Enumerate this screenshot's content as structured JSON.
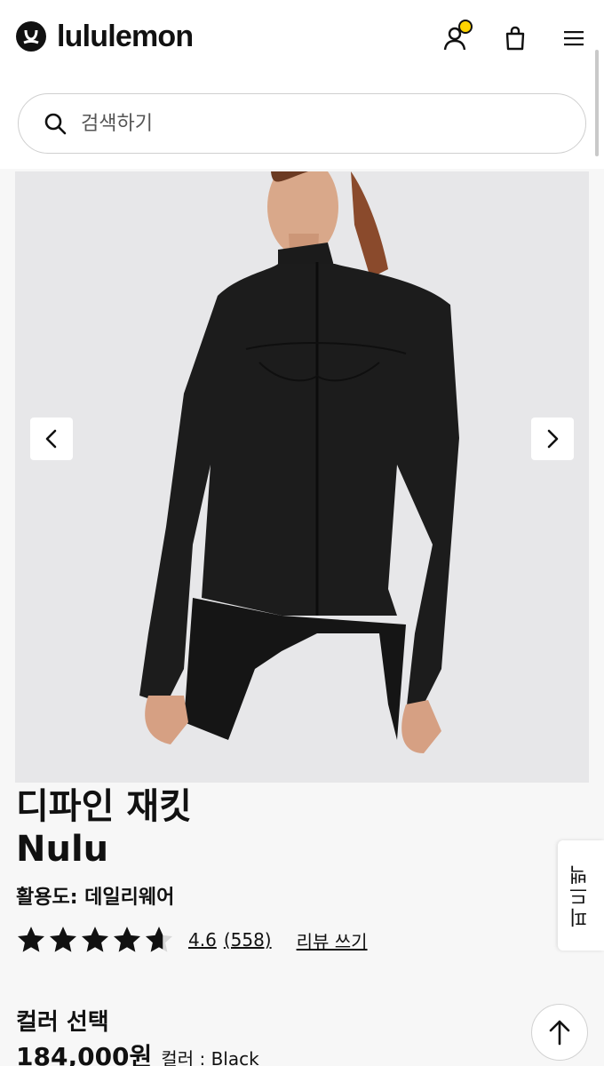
{
  "brand": {
    "name": "lululemon"
  },
  "header": {
    "account_icon": "user-icon",
    "bag_icon": "bag-icon",
    "menu_icon": "hamburger-menu-icon",
    "notification_color": "#ffd400"
  },
  "search": {
    "placeholder": "검색하기",
    "icon": "search-icon"
  },
  "gallery": {
    "prev_icon": "chevron-left-icon",
    "next_icon": "chevron-right-icon"
  },
  "product": {
    "name_line1": "디파인 재킷",
    "name_line2": "Nulu",
    "usage": "활용도: 데일리웨어",
    "rating": "4.6",
    "rating_value": 4.6,
    "review_count": "(558)",
    "write_review": "리뷰 쓰기",
    "color_section_label": "컬러 선택",
    "price": "184,000원",
    "color_prefix": "컬러 : ",
    "color_value": "Black"
  },
  "feedback": {
    "label": "피드백"
  },
  "scroll_top": {
    "icon": "arrow-up-icon"
  },
  "colors": {
    "text": "#111111",
    "accent": "#ffd400",
    "background": "#f7f7f7"
  }
}
